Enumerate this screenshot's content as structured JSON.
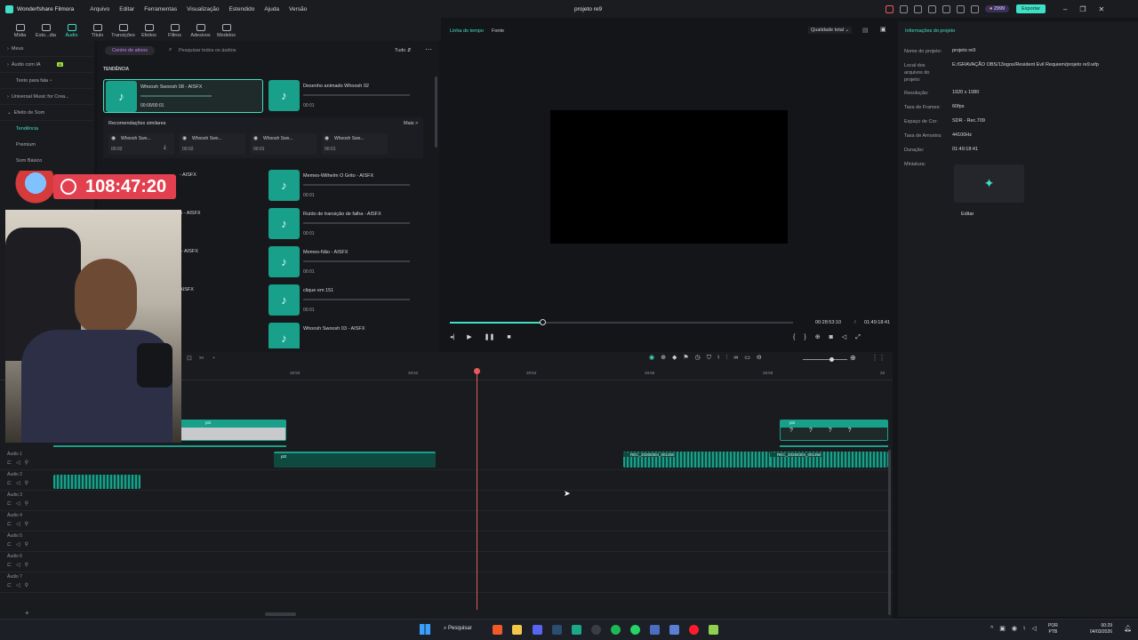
{
  "app": {
    "name": "Wonderfshare Filmora",
    "project_title": "projeto re9"
  },
  "menu": [
    "Arquivo",
    "Editar",
    "Ferramentas",
    "Visualização",
    "Estendido",
    "Ajuda",
    "Versão"
  ],
  "title_right": {
    "credits": "2999",
    "export_label": "Exportar"
  },
  "toolbar": [
    {
      "label": "Mídia",
      "icon": "media-icon"
    },
    {
      "label": "Esto...dia",
      "icon": "stock-media-icon"
    },
    {
      "label": "Áudio",
      "icon": "audio-icon",
      "active": true
    },
    {
      "label": "Título",
      "icon": "title-icon"
    },
    {
      "label": "Transições",
      "icon": "transitions-icon"
    },
    {
      "label": "Efeitos",
      "icon": "effects-icon"
    },
    {
      "label": "Filtros",
      "icon": "filters-icon"
    },
    {
      "label": "Adesivos",
      "icon": "stickers-icon"
    },
    {
      "label": "Modelos",
      "icon": "templates-icon"
    }
  ],
  "sidebar": {
    "items": [
      {
        "label": "Meus"
      },
      {
        "label": "Áudio com IA",
        "badge": "AI"
      },
      {
        "label": "Texto para fala"
      },
      {
        "label": "Universal Music for Crea..."
      },
      {
        "label": "Efeito de Som"
      }
    ],
    "sub_items": [
      {
        "label": "Tendência",
        "active": true
      },
      {
        "label": "Premium"
      },
      {
        "label": "Som Básico"
      }
    ]
  },
  "assets": {
    "tab_label": "Centro de ativos",
    "search_placeholder": "Pesquisar todos os áudios",
    "filter_label": "Tudo",
    "section_title": "TENDÊNCIA",
    "similar_title": "Recomendações similares",
    "more_label": "Mais >",
    "featured": [
      {
        "title": "Whoosh Swoosh 08 - AISFX",
        "duration": "00:00/00:01"
      },
      {
        "title": "Desenho animado Whoosh 02",
        "duration": "00:01"
      }
    ],
    "similar": [
      {
        "title": "Whoosh Swo...",
        "duration": "00:02"
      },
      {
        "title": "Whoosh Swo...",
        "duration": "00:02"
      },
      {
        "title": "Whoosh Swo...",
        "duration": "00:01"
      },
      {
        "title": "Whoosh Swo...",
        "duration": "00:01"
      }
    ],
    "left_partial": [
      {
        "title": "- AISFX"
      },
      {
        "title": "...Seco - AISFX"
      },
      {
        "title": "- AISFX"
      },
      {
        "title": "AISFX"
      }
    ],
    "right_list": [
      {
        "title": "Memes-Wilhelm O Grito - AISFX",
        "duration": "00:01"
      },
      {
        "title": "Ruído de transição de falha - AISFX",
        "duration": "00:01"
      },
      {
        "title": "Memes-Não - AISFX",
        "duration": "00:01"
      },
      {
        "title": "clique em 151",
        "duration": "00:01"
      },
      {
        "title": "Whoosh Swoosh 03 - AISFX",
        "duration": ""
      }
    ]
  },
  "preview": {
    "tabs": [
      "Linha do tempo",
      "Fonte"
    ],
    "quality_label": "Qualidade total",
    "current_time": "00:28:53:10",
    "separator": "/",
    "total_time": "01:49:18:41",
    "progress": 0.27
  },
  "stream_timer": "108:47:20",
  "project_info": {
    "title": "Informações do projeto",
    "rows": [
      {
        "k": "Nome do projeto:",
        "v": "projeto re9"
      },
      {
        "k": "Local dos arquivos do projeto:",
        "v": "E:/GRAVAÇÃO OBS/13ogos/Resident Evil Requiem/projeto re9.wfp"
      },
      {
        "k": "Resolução:",
        "v": "1920 x 1080"
      },
      {
        "k": "Taxa de Frames:",
        "v": "60fps"
      },
      {
        "k": "Espaço de Cor:",
        "v": "SDR - Rec.709"
      },
      {
        "k": "Taxa de Amostra:",
        "v": "44100Hz"
      },
      {
        "k": "Duração:",
        "v": "01:49:18:41"
      },
      {
        "k": "Miniatura:",
        "v": ""
      }
    ],
    "edit_label": "Editar"
  },
  "timeline": {
    "ruler": [
      "28:50",
      "28:52",
      "28:54",
      "28:56",
      "28:58",
      "29"
    ],
    "tracks": [
      "Áudio 1",
      "Áudio 2",
      "Áudio 3",
      "Áudio 4",
      "Áudio 5",
      "Áudio 6",
      "Áudio 7"
    ],
    "clips": {
      "video_a": "pt2",
      "video_b": "pt2",
      "audio_a": "pt2",
      "audio_b": "REC_20260304_001350",
      "audio_c": "REC_20260304_001350"
    }
  },
  "taskbar": {
    "search_label": "Pesquisar",
    "lang": "POR",
    "lang2": "PTB",
    "time": "00:29",
    "date": "04/03/2026"
  },
  "colors": {
    "accent": "#3fe0c5",
    "playhead": "#e85a5a",
    "clip_green": "#18a08a",
    "timer_bg": "#e2404f"
  }
}
